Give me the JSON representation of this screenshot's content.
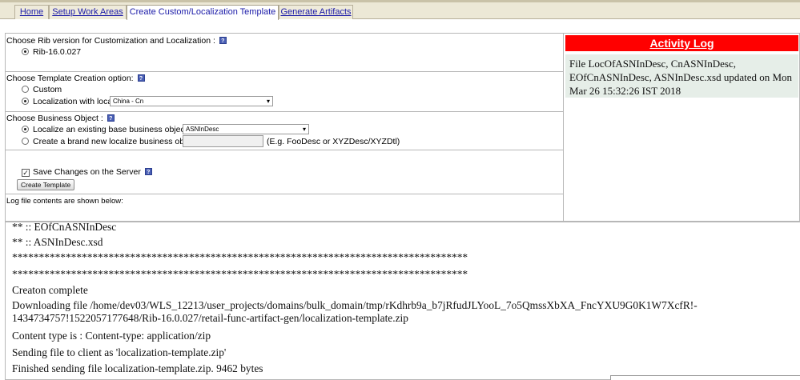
{
  "tabs": [
    {
      "label": "Home",
      "active": false
    },
    {
      "label": "Setup Work Areas",
      "active": false
    },
    {
      "label": "Create Custom/Localization Template",
      "active": true
    },
    {
      "label": "Generate Artifacts",
      "active": false
    }
  ],
  "rib_section": {
    "title": "Choose Rib version for Customization and Localization :",
    "option": "Rib-16.0.027"
  },
  "template_section": {
    "title": "Choose Template Creation option:",
    "option_custom": "Custom",
    "option_localization": "Localization with locale",
    "locale_value": "China - Cn"
  },
  "business_section": {
    "title": "Choose Business Object :",
    "option_existing": "Localize an existing base business object :",
    "existing_value": "ASNInDesc",
    "option_new": "Create a brand new localize business object :",
    "new_placeholder": "",
    "new_hint": "(E.g. FooDesc or XYZDesc/XYZDtl)"
  },
  "save_section": {
    "checkbox_label": "Save Changes on the Server",
    "button_label": "Create Template"
  },
  "log_caption": "Log file contents are shown below:",
  "activity_log": {
    "title": "Activity Log",
    "message": "File LocOfASNInDesc, CnASNInDesc, EOfCnASNInDesc, ASNInDesc.xsd updated on Mon Mar 26 15:32:26 IST 2018"
  },
  "log_lines": [
    "** :: EOfCnASNInDesc",
    "** :: ASNInDesc.xsd",
    "*************************************************************************************",
    "*************************************************************************************",
    "Creaton complete",
    "Downloading file /home/dev03/WLS_12213/user_projects/domains/bulk_domain/tmp/rKdhrb9a_b7jRfudJLYooL_7o5QmssXbXA_FncYXU9G0K1W7XcfR!-",
    "1434734757!1522057177648/Rib-16.0.027/retail-func-artifact-gen/localization-template.zip",
    "Content type is : Content-type: application/zip",
    "Sending file to client as 'localization-template.zip'",
    "Finished sending file localization-template.zip. 9462 bytes"
  ],
  "colors": {
    "tab_bar": "#ece8d6",
    "link": "#1a1aa8",
    "activity_header": "#ff0000",
    "activity_body": "#e6eee8"
  }
}
